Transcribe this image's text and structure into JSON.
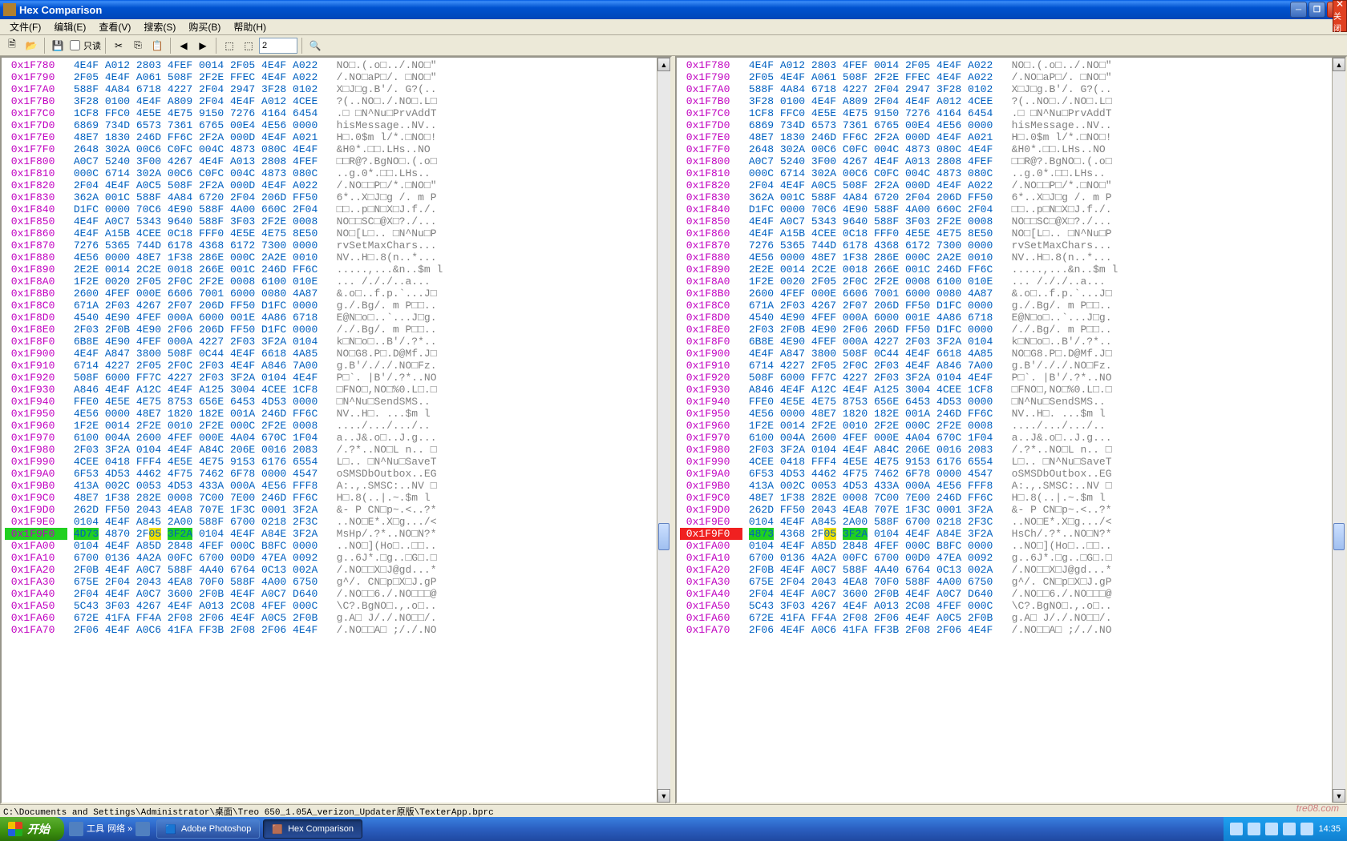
{
  "window": {
    "title": "Hex Comparison",
    "close_label": "关闭"
  },
  "menu": {
    "file": "文件(F)",
    "edit": "编辑(E)",
    "view": "查看(V)",
    "search": "搜索(S)",
    "buy": "购买(B)",
    "help": "帮助(H)"
  },
  "toolbar": {
    "readonly": "只读",
    "goto_value": "2"
  },
  "statusbar": "C:\\Documents and Settings\\Administrator\\桌面\\Treo 650_1.05A_verizon_Updater原版\\TexterApp.bprc",
  "taskbar": {
    "start": "开始",
    "tools": "工具",
    "net": "网络 »",
    "photoshop": "Adobe Photoshop",
    "hexcomp": "Hex Comparison",
    "time": "14:35"
  },
  "watermark": "tre08.com",
  "hex_left": {
    "rows": [
      {
        "a": "0x1F780",
        "h": "4E4F A012 2803 4FEF 0014 2F05 4E4F A022",
        "s": "NO□.(.o□../.NO□\""
      },
      {
        "a": "0x1F790",
        "h": "2F05 4E4F A061 508F 2F2E FFEC 4E4F A022",
        "s": "/.NO□aP□/. □NO□\""
      },
      {
        "a": "0x1F7A0",
        "h": "588F 4A84 6718 4227 2F04 2947 3F28 0102",
        "s": "X□J□g.B'/. G?(.."
      },
      {
        "a": "0x1F7B0",
        "h": "3F28 0100 4E4F A809 2F04 4E4F A012 4CEE",
        "s": "?(..NO□./.NO□.L□"
      },
      {
        "a": "0x1F7C0",
        "h": "1CF8 FFC0 4E5E 4E75 9150 7276 4164 6454",
        "s": ".□ □N^Nu□PrvAddT"
      },
      {
        "a": "0x1F7D0",
        "h": "6869 734D 6573 7361 6765 00E4 4E56 0000",
        "s": "hisMessage..NV.."
      },
      {
        "a": "0x1F7E0",
        "h": "48E7 1830 246D FF6C 2F2A 000D 4E4F A021",
        "s": "H□.0$m l/*.□NO□!"
      },
      {
        "a": "0x1F7F0",
        "h": "2648 302A 00C6 C0FC 004C 4873 080C 4E4F",
        "s": "&H0*.□□.LHs..NO"
      },
      {
        "a": "0x1F800",
        "h": "A0C7 5240 3F00 4267 4E4F A013 2808 4FEF",
        "s": "□□R@?.BgNO□.(.o□"
      },
      {
        "a": "0x1F810",
        "h": "000C 6714 302A 00C6 C0FC 004C 4873 080C",
        "s": "..g.0*.□□.LHs.."
      },
      {
        "a": "0x1F820",
        "h": "2F04 4E4F A0C5 508F 2F2A 000D 4E4F A022",
        "s": "/.NO□□P□/*.□NO□\""
      },
      {
        "a": "0x1F830",
        "h": "362A 001C 588F 4A84 6720 2F04 206D FF50",
        "s": "6*..X□J□g /. m P"
      },
      {
        "a": "0x1F840",
        "h": "D1FC 0000 70C6 4E90 588F 4A00 660C 2F04",
        "s": "□□..p□N□X□J.f./."
      },
      {
        "a": "0x1F850",
        "h": "4E4F A0C7 5343 9640 588F 3F03 2F2E 0008",
        "s": "NO□□SC□@X□?./..."
      },
      {
        "a": "0x1F860",
        "h": "4E4F A15B 4CEE 0C18 FFF0 4E5E 4E75 8E50",
        "s": "NO□[L□.. □N^Nu□P"
      },
      {
        "a": "0x1F870",
        "h": "7276 5365 744D 6178 4368 6172 7300 0000",
        "s": "rvSetMaxChars..."
      },
      {
        "a": "0x1F880",
        "h": "4E56 0000 48E7 1F38 286E 000C 2A2E 0010",
        "s": "NV..H□.8(n..*..."
      },
      {
        "a": "0x1F890",
        "h": "2E2E 0014 2C2E 0018 266E 001C 246D FF6C",
        "s": ".....,...&n..$m l"
      },
      {
        "a": "0x1F8A0",
        "h": "1F2E 0020 2F05 2F0C 2F2E 0008 6100 010E",
        "s": "... /././..a..."
      },
      {
        "a": "0x1F8B0",
        "h": "2600 4FEF 000E 6606 7001 6000 0080 4A87",
        "s": "&.o□..f.p.`...J□"
      },
      {
        "a": "0x1F8C0",
        "h": "671A 2F03 4267 2F07 206D FF50 D1FC 0000",
        "s": "g./.Bg/. m P□□.."
      },
      {
        "a": "0x1F8D0",
        "h": "4540 4E90 4FEF 000A 6000 001E 4A86 6718",
        "s": "E@N□o□..`...J□g."
      },
      {
        "a": "0x1F8E0",
        "h": "2F03 2F0B 4E90 2F06 206D FF50 D1FC 0000",
        "s": "/./.Bg/. m P□□.."
      },
      {
        "a": "0x1F8F0",
        "h": "6B8E 4E90 4FEF 000A 4227 2F03 3F2A 0104",
        "s": "k□N□o□..B'/.?*.."
      },
      {
        "a": "0x1F900",
        "h": "4E4F A847 3800 508F 0C44 4E4F 6618 4A85",
        "s": "NO□G8.P□.D@Mf.J□"
      },
      {
        "a": "0x1F910",
        "h": "6714 4227 2F05 2F0C 2F03 4E4F A846 7A00",
        "s": "g.B'/././.NO□Fz."
      },
      {
        "a": "0x1F920",
        "h": "508F 6000 FF7C 4227 2F03 3F2A 0104 4E4F",
        "s": "P□`. |B'/.?*..NO"
      },
      {
        "a": "0x1F930",
        "h": "A846 4E4F A12C 4E4F A125 3004 4CEE 1CF8",
        "s": "□FNO□,NO□%0.L□.□"
      },
      {
        "a": "0x1F940",
        "h": "FFE0 4E5E 4E75 8753 656E 6453 4D53 0000",
        "s": "□N^Nu□SendSMS.."
      },
      {
        "a": "0x1F950",
        "h": "4E56 0000 48E7 1820 182E 001A 246D FF6C",
        "s": "NV..H□. ...$m l"
      },
      {
        "a": "0x1F960",
        "h": "1F2E 0014 2F2E 0010 2F2E 000C 2F2E 0008",
        "s": "..../.../.../.."
      },
      {
        "a": "0x1F970",
        "h": "6100 004A 2600 4FEF 000E 4A04 670C 1F04",
        "s": "a..J&.o□..J.g..."
      },
      {
        "a": "0x1F980",
        "h": "2F03 3F2A 0104 4E4F A84C 206E 0016 2083",
        "s": "/.?*..NO□L n.. □"
      },
      {
        "a": "0x1F990",
        "h": "4CEE 0418 FFF4 4E5E 4E75 9153 6176 6554",
        "s": "L□.. □N^Nu□SaveT"
      },
      {
        "a": "0x1F9A0",
        "h": "6F53 4D53 4462 4F75 7462 6F78 0000 4547",
        "s": "oSMSDbOutbox..EG"
      },
      {
        "a": "0x1F9B0",
        "h": "413A 002C 0053 4D53 433A 000A 4E56 FFF8",
        "s": "A:.,.SMSC:..NV □"
      },
      {
        "a": "0x1F9C0",
        "h": "48E7 1F38 282E 0008 7C00 7E00 246D FF6C",
        "s": "H□.8(..|.~.$m l"
      },
      {
        "a": "0x1F9D0",
        "h": "262D FF50 2043 4EA8 707E 1F3C 0001 3F2A",
        "s": "&- P CN□p~.<..?*"
      },
      {
        "a": "0x1F9E0",
        "h": "0104 4E4F A845 2A00 588F 6700 0218 2F3C",
        "s": "..NO□E*.X□g.../<"
      },
      {
        "a": "0x1F9F0",
        "h": "4D73 4870 2F05 3F2A 0104 4E4F A84E 3F2A",
        "s": "MsHp/.?*..NO□N?*",
        "hl": [
          {
            "i": 0,
            "c": "hlg"
          },
          {
            "i": 1,
            "c": "hlg"
          },
          {
            "i": 5,
            "c": "hly"
          },
          {
            "i": 6,
            "c": "hlg"
          },
          {
            "i": 7,
            "c": "hlg"
          }
        ],
        "row_hl": "hlg"
      },
      {
        "a": "0x1FA00",
        "h": "0104 4E4F A85D 2848 4FEF 000C B8FC 0000",
        "s": "..NO□](Ho□..□□.."
      },
      {
        "a": "0x1FA10",
        "h": "6700 0136 4A2A 00FC 6700 00D0 47EA 0092",
        "s": "g..6J*.□g..□G□.□"
      },
      {
        "a": "0x1FA20",
        "h": "2F0B 4E4F A0C7 588F 4A40 6764 0C13 002A",
        "s": "/.NO□□X□J@gd...*"
      },
      {
        "a": "0x1FA30",
        "h": "675E 2F04 2043 4EA8 70F0 588F 4A00 6750",
        "s": "g^/. CN□p□X□J.gP"
      },
      {
        "a": "0x1FA40",
        "h": "2F04 4E4F A0C7 3600 2F0B 4E4F A0C7 D640",
        "s": "/.NO□□6./.NO□□□@"
      },
      {
        "a": "0x1FA50",
        "h": "5C43 3F03 4267 4E4F A013 2C08 4FEF 000C",
        "s": "\\C?.BgNO□.,.o□.."
      },
      {
        "a": "0x1FA60",
        "h": "672E 41FA FF4A 2F08 2F06 4E4F A0C5 2F0B",
        "s": "g.A□ J/./.NO□□/."
      },
      {
        "a": "0x1FA70",
        "h": "2F06 4E4F A0C6 41FA FF3B 2F08 2F06 4E4F",
        "s": "/.NO□□A□ ;/./.NO"
      }
    ]
  },
  "hex_right": {
    "rows": [
      {
        "a": "0x1F780",
        "h": "4E4F A012 2803 4FEF 0014 2F05 4E4F A022",
        "s": "NO□.(.o□../.NO□\""
      },
      {
        "a": "0x1F790",
        "h": "2F05 4E4F A061 508F 2F2E FFEC 4E4F A022",
        "s": "/.NO□aP□/. □NO□\""
      },
      {
        "a": "0x1F7A0",
        "h": "588F 4A84 6718 4227 2F04 2947 3F28 0102",
        "s": "X□J□g.B'/. G?(.."
      },
      {
        "a": "0x1F7B0",
        "h": "3F28 0100 4E4F A809 2F04 4E4F A012 4CEE",
        "s": "?(..NO□./.NO□.L□"
      },
      {
        "a": "0x1F7C0",
        "h": "1CF8 FFC0 4E5E 4E75 9150 7276 4164 6454",
        "s": ".□ □N^Nu□PrvAddT"
      },
      {
        "a": "0x1F7D0",
        "h": "6869 734D 6573 7361 6765 00E4 4E56 0000",
        "s": "hisMessage..NV.."
      },
      {
        "a": "0x1F7E0",
        "h": "48E7 1830 246D FF6C 2F2A 000D 4E4F A021",
        "s": "H□.0$m l/*.□NO□!"
      },
      {
        "a": "0x1F7F0",
        "h": "2648 302A 00C6 C0FC 004C 4873 080C 4E4F",
        "s": "&H0*.□□.LHs..NO"
      },
      {
        "a": "0x1F800",
        "h": "A0C7 5240 3F00 4267 4E4F A013 2808 4FEF",
        "s": "□□R@?.BgNO□.(.o□"
      },
      {
        "a": "0x1F810",
        "h": "000C 6714 302A 00C6 C0FC 004C 4873 080C",
        "s": "..g.0*.□□.LHs.."
      },
      {
        "a": "0x1F820",
        "h": "2F04 4E4F A0C5 508F 2F2A 000D 4E4F A022",
        "s": "/.NO□□P□/*.□NO□\""
      },
      {
        "a": "0x1F830",
        "h": "362A 001C 588F 4A84 6720 2F04 206D FF50",
        "s": "6*..X□J□g /. m P"
      },
      {
        "a": "0x1F840",
        "h": "D1FC 0000 70C6 4E90 588F 4A00 660C 2F04",
        "s": "□□..p□N□X□J.f./."
      },
      {
        "a": "0x1F850",
        "h": "4E4F A0C7 5343 9640 588F 3F03 2F2E 0008",
        "s": "NO□□SC□@X□?./..."
      },
      {
        "a": "0x1F860",
        "h": "4E4F A15B 4CEE 0C18 FFF0 4E5E 4E75 8E50",
        "s": "NO□[L□.. □N^Nu□P"
      },
      {
        "a": "0x1F870",
        "h": "7276 5365 744D 6178 4368 6172 7300 0000",
        "s": "rvSetMaxChars..."
      },
      {
        "a": "0x1F880",
        "h": "4E56 0000 48E7 1F38 286E 000C 2A2E 0010",
        "s": "NV..H□.8(n..*..."
      },
      {
        "a": "0x1F890",
        "h": "2E2E 0014 2C2E 0018 266E 001C 246D FF6C",
        "s": ".....,...&n..$m l"
      },
      {
        "a": "0x1F8A0",
        "h": "1F2E 0020 2F05 2F0C 2F2E 0008 6100 010E",
        "s": "... /././..a..."
      },
      {
        "a": "0x1F8B0",
        "h": "2600 4FEF 000E 6606 7001 6000 0080 4A87",
        "s": "&.o□..f.p.`...J□"
      },
      {
        "a": "0x1F8C0",
        "h": "671A 2F03 4267 2F07 206D FF50 D1FC 0000",
        "s": "g./.Bg/. m P□□.."
      },
      {
        "a": "0x1F8D0",
        "h": "4540 4E90 4FEF 000A 6000 001E 4A86 6718",
        "s": "E@N□o□..`...J□g."
      },
      {
        "a": "0x1F8E0",
        "h": "2F03 2F0B 4E90 2F06 206D FF50 D1FC 0000",
        "s": "/./.Bg/. m P□□.."
      },
      {
        "a": "0x1F8F0",
        "h": "6B8E 4E90 4FEF 000A 4227 2F03 3F2A 0104",
        "s": "k□N□o□..B'/.?*.."
      },
      {
        "a": "0x1F900",
        "h": "4E4F A847 3800 508F 0C44 4E4F 6618 4A85",
        "s": "NO□G8.P□.D@Mf.J□"
      },
      {
        "a": "0x1F910",
        "h": "6714 4227 2F05 2F0C 2F03 4E4F A846 7A00",
        "s": "g.B'/././.NO□Fz."
      },
      {
        "a": "0x1F920",
        "h": "508F 6000 FF7C 4227 2F03 3F2A 0104 4E4F",
        "s": "P□`. |B'/.?*..NO"
      },
      {
        "a": "0x1F930",
        "h": "A846 4E4F A12C 4E4F A125 3004 4CEE 1CF8",
        "s": "□FNO□,NO□%0.L□.□"
      },
      {
        "a": "0x1F940",
        "h": "FFE0 4E5E 4E75 8753 656E 6453 4D53 0000",
        "s": "□N^Nu□SendSMS.."
      },
      {
        "a": "0x1F950",
        "h": "4E56 0000 48E7 1820 182E 001A 246D FF6C",
        "s": "NV..H□. ...$m l"
      },
      {
        "a": "0x1F960",
        "h": "1F2E 0014 2F2E 0010 2F2E 000C 2F2E 0008",
        "s": "..../.../.../.."
      },
      {
        "a": "0x1F970",
        "h": "6100 004A 2600 4FEF 000E 4A04 670C 1F04",
        "s": "a..J&.o□..J.g..."
      },
      {
        "a": "0x1F980",
        "h": "2F03 3F2A 0104 4E4F A84C 206E 0016 2083",
        "s": "/.?*..NO□L n.. □"
      },
      {
        "a": "0x1F990",
        "h": "4CEE 0418 FFF4 4E5E 4E75 9153 6176 6554",
        "s": "L□.. □N^Nu□SaveT"
      },
      {
        "a": "0x1F9A0",
        "h": "6F53 4D53 4462 4F75 7462 6F78 0000 4547",
        "s": "oSMSDbOutbox..EG"
      },
      {
        "a": "0x1F9B0",
        "h": "413A 002C 0053 4D53 433A 000A 4E56 FFF8",
        "s": "A:.,.SMSC:..NV □"
      },
      {
        "a": "0x1F9C0",
        "h": "48E7 1F38 282E 0008 7C00 7E00 246D FF6C",
        "s": "H□.8(..|.~.$m l"
      },
      {
        "a": "0x1F9D0",
        "h": "262D FF50 2043 4EA8 707E 1F3C 0001 3F2A",
        "s": "&- P CN□p~.<..?*"
      },
      {
        "a": "0x1F9E0",
        "h": "0104 4E4F A845 2A00 588F 6700 0218 2F3C",
        "s": "..NO□E*.X□g.../<"
      },
      {
        "a": "0x1F9F0",
        "h": "4873 4368 2F05 3F2A 0104 4E4F A84E 3F2A",
        "s": "HsCh/.?*..NO□N?*",
        "hl": [
          {
            "i": 0,
            "c": "hlg"
          },
          {
            "i": 1,
            "c": "hlg"
          },
          {
            "i": 5,
            "c": "hly"
          },
          {
            "i": 6,
            "c": "hlg"
          },
          {
            "i": 7,
            "c": "hlg"
          }
        ],
        "row_hl": "hlr"
      },
      {
        "a": "0x1FA00",
        "h": "0104 4E4F A85D 2848 4FEF 000C B8FC 0000",
        "s": "..NO□](Ho□..□□.."
      },
      {
        "a": "0x1FA10",
        "h": "6700 0136 4A2A 00FC 6700 00D0 47EA 0092",
        "s": "g..6J*.□g..□G□.□"
      },
      {
        "a": "0x1FA20",
        "h": "2F0B 4E4F A0C7 588F 4A40 6764 0C13 002A",
        "s": "/.NO□□X□J@gd...*"
      },
      {
        "a": "0x1FA30",
        "h": "675E 2F04 2043 4EA8 70F0 588F 4A00 6750",
        "s": "g^/. CN□p□X□J.gP"
      },
      {
        "a": "0x1FA40",
        "h": "2F04 4E4F A0C7 3600 2F0B 4E4F A0C7 D640",
        "s": "/.NO□□6./.NO□□□@"
      },
      {
        "a": "0x1FA50",
        "h": "5C43 3F03 4267 4E4F A013 2C08 4FEF 000C",
        "s": "\\C?.BgNO□.,.o□.."
      },
      {
        "a": "0x1FA60",
        "h": "672E 41FA FF4A 2F08 2F06 4E4F A0C5 2F0B",
        "s": "g.A□ J/./.NO□□/."
      },
      {
        "a": "0x1FA70",
        "h": "2F06 4E4F A0C6 41FA FF3B 2F08 2F06 4E4F",
        "s": "/.NO□□A□ ;/./.NO"
      }
    ]
  }
}
